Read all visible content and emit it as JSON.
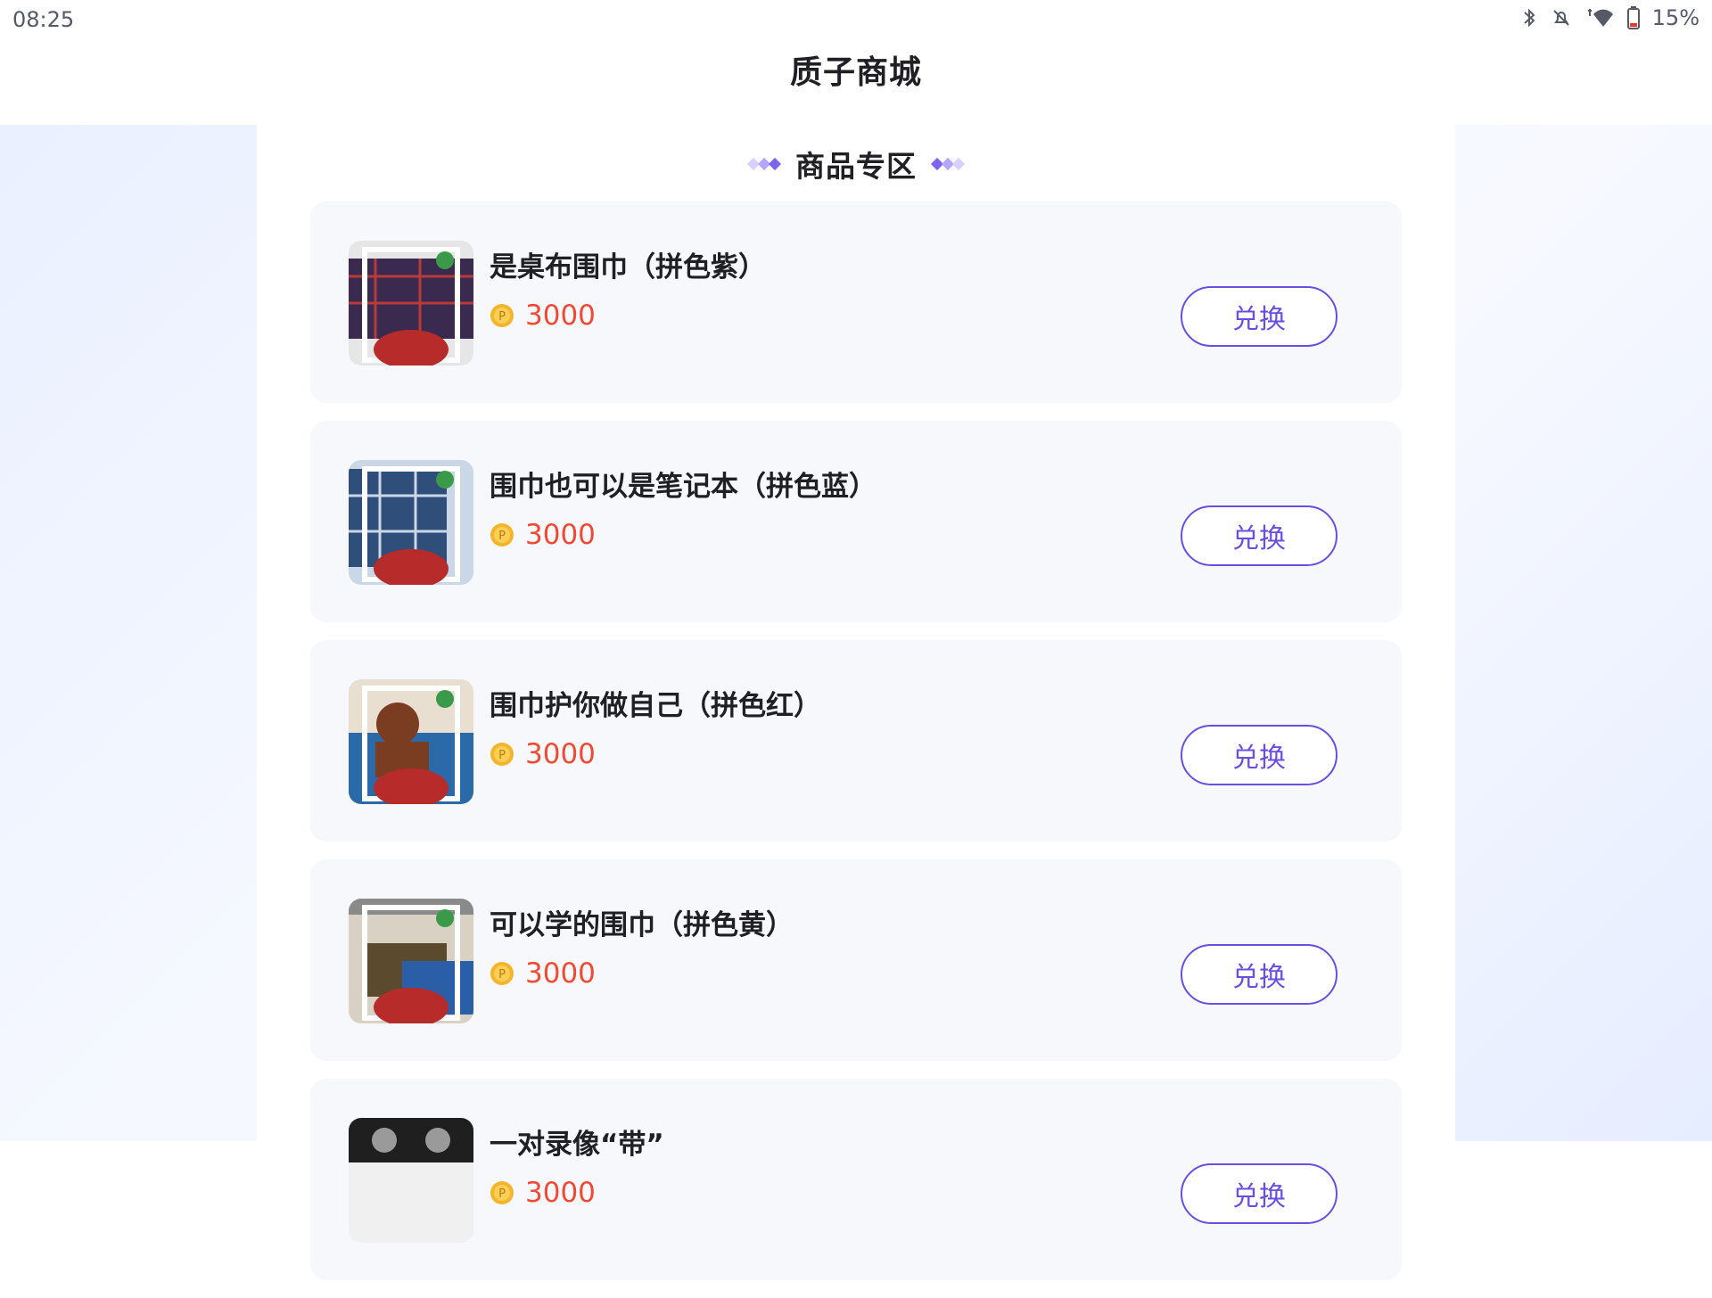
{
  "status_bar": {
    "time": "08:25",
    "battery": "15%"
  },
  "header": {
    "title": "质子商城"
  },
  "section": {
    "title": "商品专区"
  },
  "colors": {
    "accent": "#6a4ee0",
    "price": "#ef4b34",
    "card_bg": "#f7f8fc"
  },
  "products": [
    {
      "name": "是桌布围巾（拼色紫）",
      "price": "3000",
      "button": "兑换",
      "thumb_colors": [
        "#3a2a4f",
        "#b83a3a",
        "#e6e6e6"
      ]
    },
    {
      "name": "围巾也可以是笔记本（拼色蓝）",
      "price": "3000",
      "button": "兑换",
      "thumb_colors": [
        "#2f4f7a",
        "#c9d7e6",
        "#b83a3a"
      ]
    },
    {
      "name": "围巾护你做自己（拼色红）",
      "price": "3000",
      "button": "兑换",
      "thumb_colors": [
        "#7a3d22",
        "#2a6aa8",
        "#e9dfd0"
      ]
    },
    {
      "name": "可以学的围巾（拼色黄）",
      "price": "3000",
      "button": "兑换",
      "thumb_colors": [
        "#5b4a2e",
        "#2a5fa8",
        "#d9d2c4"
      ]
    },
    {
      "name": "一对录像“带”",
      "price": "3000",
      "button": "兑换",
      "thumb_colors": [
        "#1f1f1f",
        "#9a9a9a",
        "#f0f0f0"
      ]
    }
  ]
}
